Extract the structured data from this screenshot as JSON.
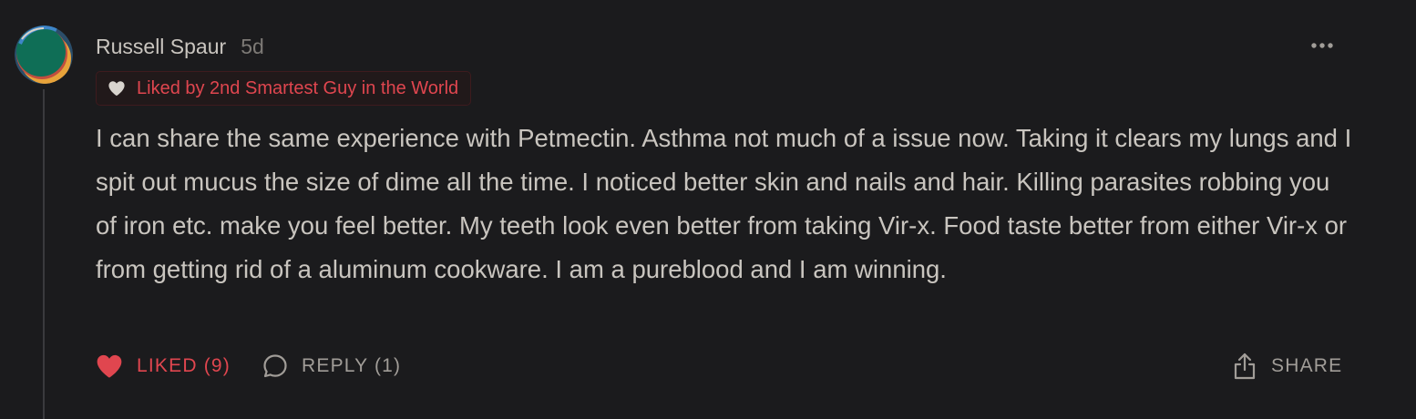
{
  "comment": {
    "author": "Russell Spaur",
    "time": "5d",
    "liked_badge": "Liked by 2nd Smartest Guy in the World",
    "body": "I can share the same experience with Petmectin. Asthma not much of a issue now. Taking it clears my lungs and I spit out mucus the size of dime all the time. I noticed better skin and nails and hair. Killing parasites robbing you of iron etc. make you feel better. My teeth look even better from taking Vir-x. Food taste better from either Vir-x or from getting rid of a aluminum cookware. I am a pureblood and I am winning.",
    "actions": {
      "like_label": "LIKED (9)",
      "reply_label": "REPLY (1)",
      "share_label": "SHARE"
    }
  },
  "icons": {
    "avatar": "avatar",
    "more": "ellipsis-icon",
    "badge_heart": "heart-icon",
    "like": "heart-filled-icon",
    "reply": "speech-bubble-icon",
    "share": "share-icon"
  },
  "colors": {
    "background": "#1b1b1d",
    "text": "#c9c5bf",
    "muted": "#7d7a76",
    "accent_red": "#e0464f",
    "avatar_green": "#0f6e56",
    "avatar_orange": "#e8a33a",
    "avatar_blue": "#3e86c9"
  }
}
